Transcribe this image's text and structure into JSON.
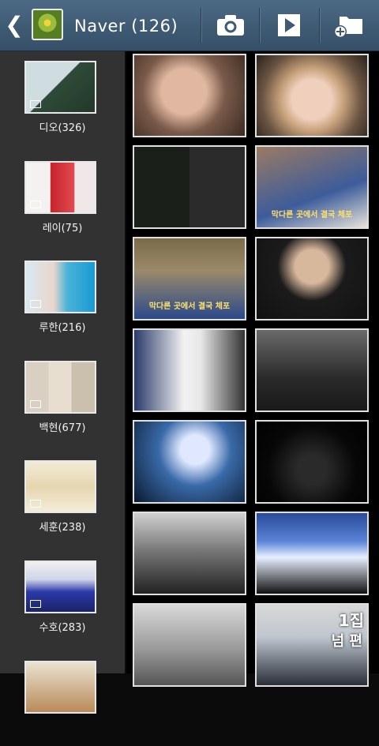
{
  "header": {
    "title": "Naver (126)",
    "back_icon": "chevron-left-icon",
    "buttons": [
      {
        "name": "camera-button",
        "icon": "camera-icon"
      },
      {
        "name": "slideshow-button",
        "icon": "play-icon"
      },
      {
        "name": "new-album-button",
        "icon": "folder-add-icon"
      }
    ]
  },
  "albums": [
    {
      "label": "디오(326)"
    },
    {
      "label": "레이(75)"
    },
    {
      "label": "루한(216)"
    },
    {
      "label": "백현(677)"
    },
    {
      "label": "세훈(238)"
    },
    {
      "label": "수호(283)"
    }
  ],
  "grid": {
    "captions": [
      "막다른 곳에서 결국 체포",
      "막다른 곳에서 결국 체포"
    ],
    "badges": [
      "1집",
      "넘 편"
    ]
  },
  "colors": {
    "header": "#3f5a73",
    "sidebar": "#323232",
    "grid_background": "#000000",
    "thumb_border": "#e0e0e0"
  }
}
